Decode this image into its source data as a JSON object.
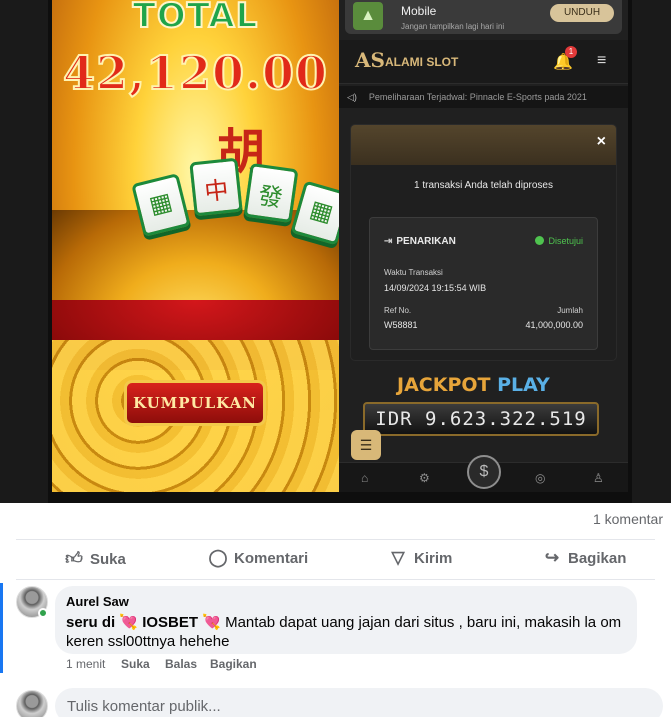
{
  "game": {
    "total_label": "TOTAL",
    "amount": "42,120.00",
    "hu_char": "胡",
    "tile_chars": [
      "中",
      "發",
      "▦"
    ],
    "collect_button": "KUMPULKAN"
  },
  "phone": {
    "notification": {
      "title": "Mobile",
      "subtitle": "Jangan tampilkan lagi hari ini",
      "button": "UNDUH"
    },
    "site": {
      "logo": "AS",
      "name": "ALAMI SLOT",
      "bell_badge": "1"
    },
    "ticker_text": "Pemeliharaan Terjadwal: Pinnacle E-Sports pada 2021",
    "modal": {
      "message": "1 transaksi Anda telah diproses",
      "card": {
        "title": "PENARIKAN",
        "status": "Disetujui",
        "time_label": "Waktu Transaksi",
        "time_value": "14/09/2024 19:15:54 WIB",
        "ref_label": "Ref No.",
        "ref_value": "W58881",
        "amount_label": "Jumlah",
        "amount_value": "41,000,000.00"
      }
    },
    "jackpot": {
      "title_part1": "JACKPOT",
      "title_part2": "PLAY",
      "value": "IDR 9.623.322.519"
    }
  },
  "post": {
    "comment_count": "1 komentar",
    "actions": {
      "like": "Suka",
      "comment": "Komentari",
      "send": "Kirim",
      "share": "Bagikan"
    }
  },
  "comment": {
    "author": "Aurel Saw",
    "text_prefix": "seru di",
    "brand": "IOSBET",
    "text_body": "Mantab dapat uang jajan dari situs , baru ini, makasih la om keren ssl00ttnya hehehe",
    "time": "1 menit",
    "like": "Suka",
    "reply": "Balas",
    "share": "Bagikan"
  },
  "composer": {
    "placeholder": "Tulis komentar publik..."
  },
  "colors": {
    "fb_blue": "#1877f2",
    "online_green": "#31a24c",
    "approved_green": "#4fc34f",
    "gold": "#d8b87a"
  }
}
